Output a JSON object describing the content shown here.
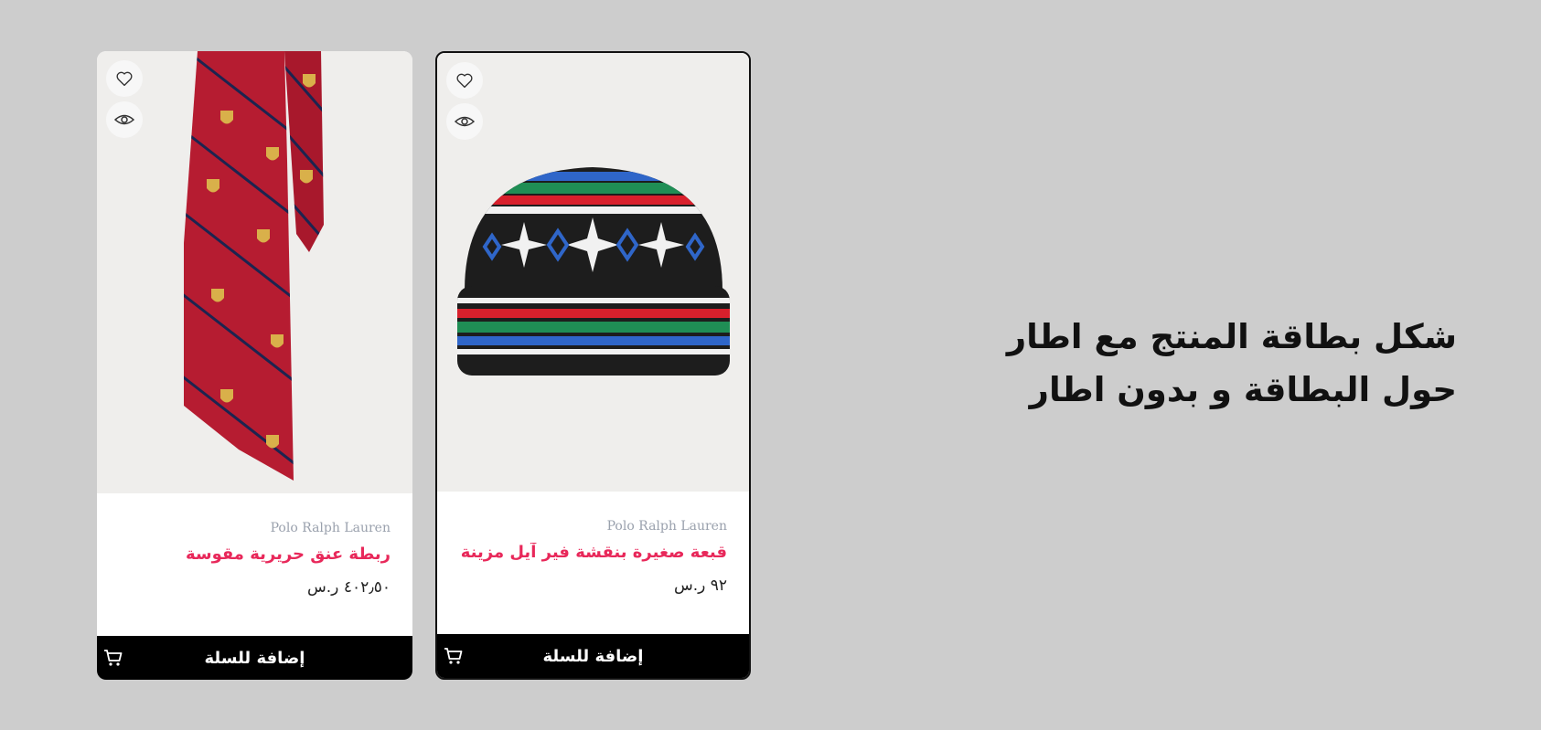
{
  "heading": "شكل بطاقة المنتج مع اطار حول البطاقة و بدون اطار",
  "cards": [
    {
      "brand": "Polo Ralph Lauren",
      "title": "ربطة عنق حريرية مقوسة",
      "price": "٤٠٢٫٥٠ ر.س",
      "cart_label": "إضافة للسلة",
      "bordered": false,
      "image": "red-silk-tie"
    },
    {
      "brand": "Polo Ralph Lauren",
      "title": "قبعة صغيرة بنقشة فير آيل مزينة بد...",
      "price": "٩٢ ر.س",
      "cart_label": "إضافة للسلة",
      "bordered": true,
      "image": "fair-isle-beanie"
    }
  ],
  "icons": {
    "favorite": "heart-icon",
    "quick_view": "eye-icon",
    "cart": "cart-icon"
  },
  "colors": {
    "background": "#cdcdcd",
    "title": "#e8285a",
    "brand": "#9aa1ad",
    "cart_bar": "#000000"
  }
}
